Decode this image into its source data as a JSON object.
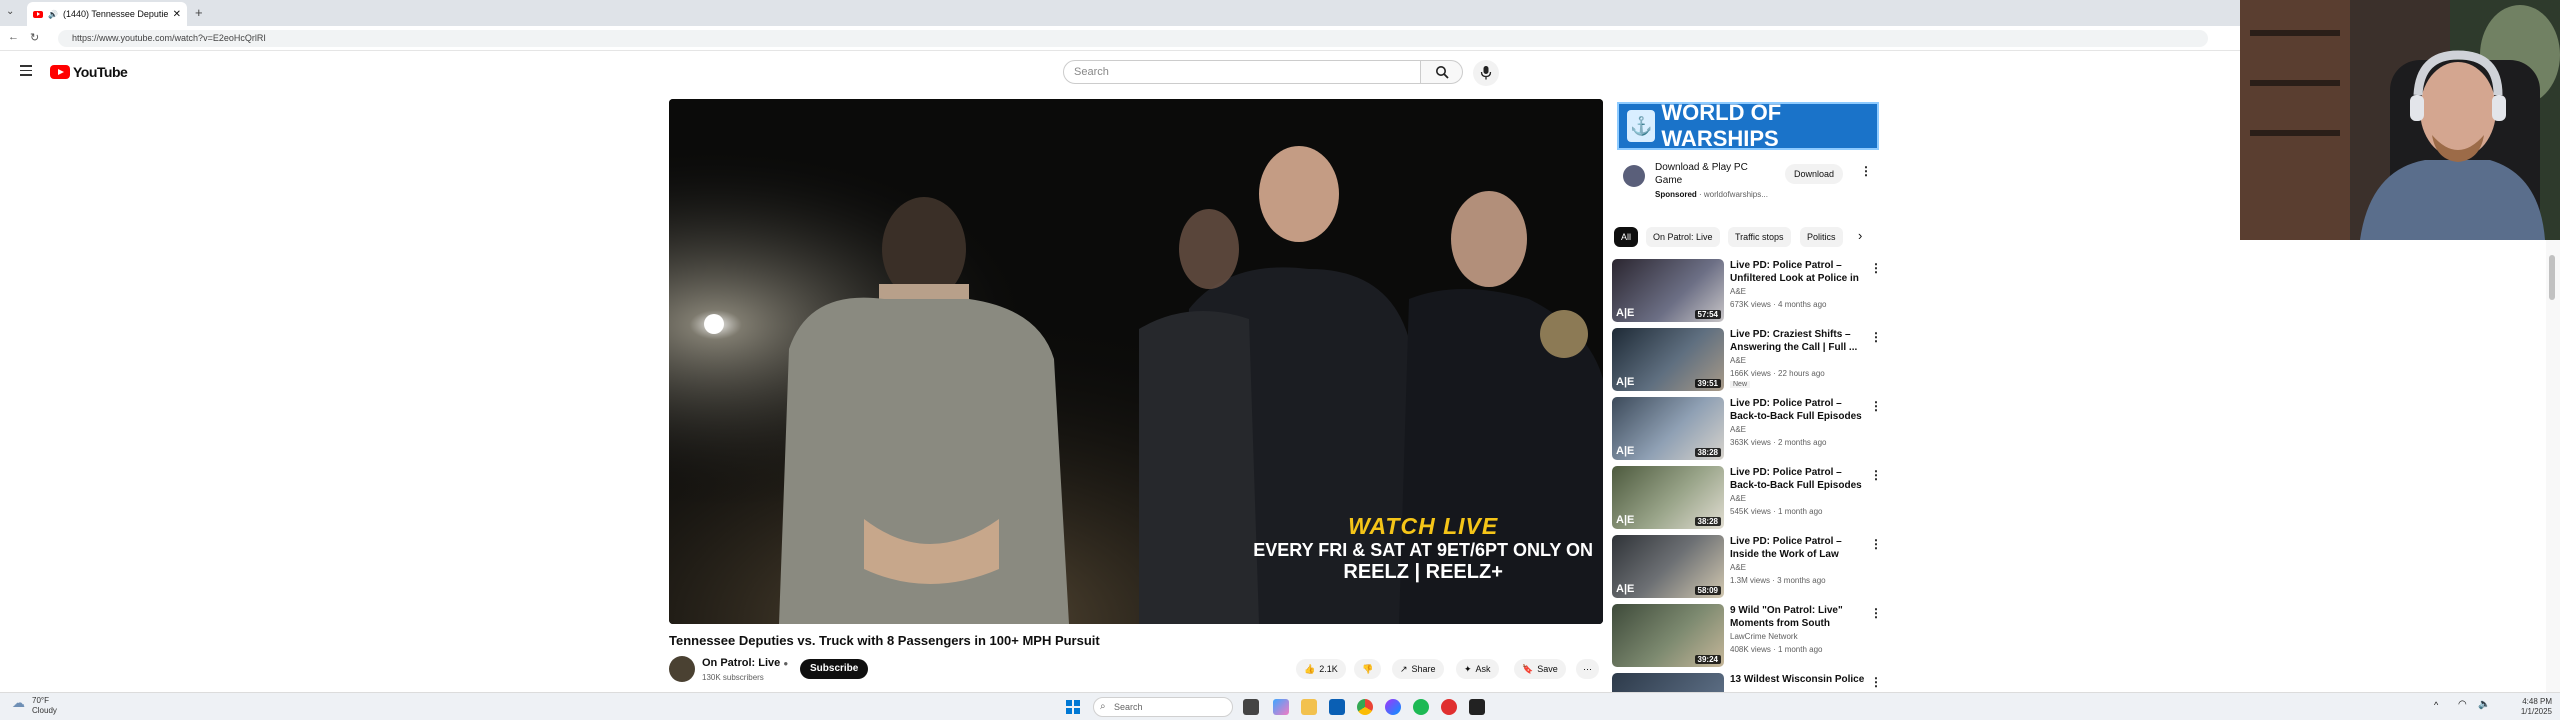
{
  "browser": {
    "tab_title": "(1440) Tennessee Deputies vs. ...",
    "url": "https://www.youtube.com/watch?v=E2eoHcQrlRI",
    "new_tab": "+"
  },
  "youtube": {
    "logo_text": "YouTube",
    "search_placeholder": "Search"
  },
  "video": {
    "overlay_line1": "WATCH LIVE",
    "overlay_line2": "EVERY FRI & SAT AT 9ET/6PT ONLY ON",
    "overlay_line3": "REELZ | REELZ+",
    "title": "Tennessee Deputies vs. Truck with 8 Passengers in 100+ MPH Pursuit",
    "channel": "On Patrol: Live",
    "subscribers": "130K subscribers",
    "subscribe": "Subscribe",
    "likes": "2.1K",
    "share": "Share",
    "ask": "Ask",
    "save": "Save"
  },
  "ad": {
    "banner": "WORLD OF WARSHIPS",
    "headline": "Download & Play PC Game",
    "sponsored": "Sponsored",
    "domain": "worldofwarships...",
    "cta": "Download"
  },
  "chips": [
    "All",
    "On Patrol: Live",
    "Traffic stops",
    "Politics"
  ],
  "recommendations": [
    {
      "title": "Live PD: Police Patrol – Unfiltered Look at Police in ...",
      "channel": "A&E",
      "meta": "673K views · 4 months ago",
      "duration": "57:54",
      "badge": ""
    },
    {
      "title": "Live PD: Craziest Shifts – Answering the Call | Full ...",
      "channel": "A&E",
      "meta": "166K views · 22 hours ago",
      "duration": "39:51",
      "badge": "New"
    },
    {
      "title": "Live PD: Police Patrol – Back-to-Back Full Episodes – ...",
      "channel": "A&E",
      "meta": "363K views · 2 months ago",
      "duration": "38:28",
      "badge": ""
    },
    {
      "title": "Live PD: Police Patrol – Back-to-Back Full Episodes – ...",
      "channel": "A&E",
      "meta": "545K views · 1 month ago",
      "duration": "38:28",
      "badge": ""
    },
    {
      "title": "Live PD: Police Patrol – Inside the Work of Law Enforcement ...",
      "channel": "A&E",
      "meta": "1.3M views · 3 months ago",
      "duration": "58:09",
      "badge": ""
    },
    {
      "title": "9 Wild \"On Patrol: Live\" Moments from South Carolina",
      "channel": "LawCrime Network",
      "meta": "408K views · 1 month ago",
      "duration": "39:24",
      "badge": ""
    },
    {
      "title": "13 Wildest Wisconsin Police",
      "channel": "",
      "meta": "",
      "duration": "",
      "badge": ""
    }
  ],
  "taskbar": {
    "weather_temp": "70°F",
    "weather_desc": "Cloudy",
    "search": "Search",
    "time": "4:48 PM",
    "date": "1/1/2025"
  },
  "colors": {
    "youtube_red": "#ff0000",
    "warships_blue": "#1a73c9",
    "overlay_yellow": "#f5c518"
  }
}
